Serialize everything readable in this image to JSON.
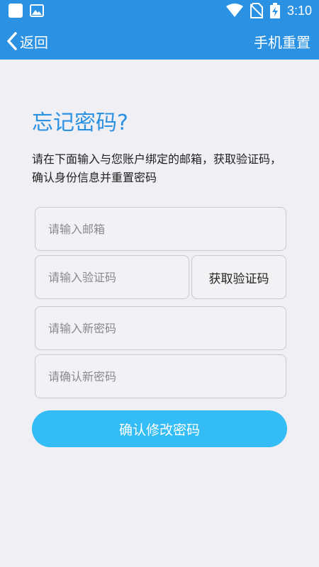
{
  "status_bar": {
    "time": "3:10"
  },
  "app_bar": {
    "back_label": "返回",
    "title": "手机重置"
  },
  "form": {
    "heading": "忘记密码?",
    "description": "请在下面输入与您账户绑定的邮箱，获取验证码，确认身份信息并重置密码",
    "email_placeholder": "请输入邮箱",
    "code_placeholder": "请输入验证码",
    "get_code_label": "获取验证码",
    "new_password_placeholder": "请输入新密码",
    "confirm_password_placeholder": "请确认新密码",
    "submit_label": "确认修改密码"
  },
  "colors": {
    "primary": "#2b91e3",
    "button": "#33bcf5",
    "background": "#efeff4"
  }
}
